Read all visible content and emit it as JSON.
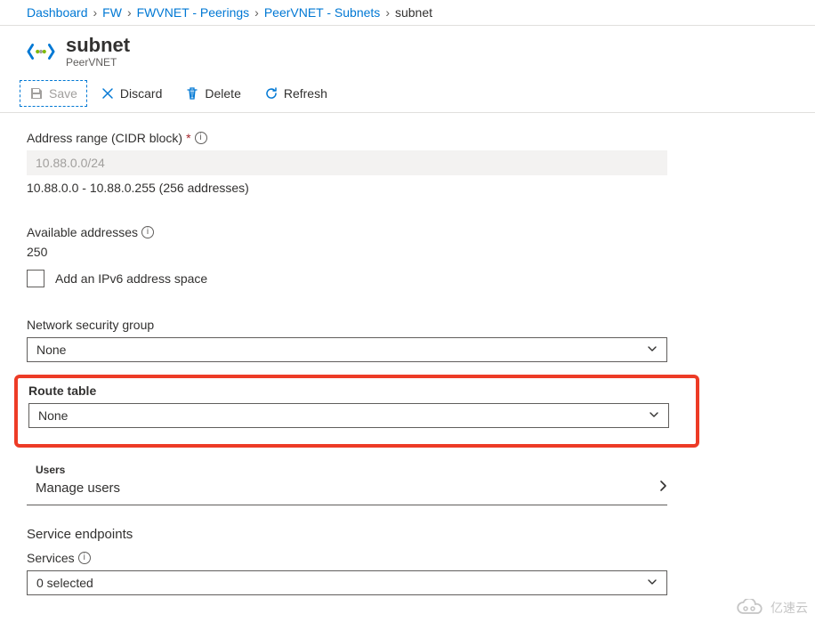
{
  "breadcrumb": {
    "items": [
      {
        "label": "Dashboard"
      },
      {
        "label": "FW"
      },
      {
        "label": "FWVNET - Peerings"
      },
      {
        "label": "PeerVNET - Subnets"
      }
    ],
    "current": "subnet"
  },
  "header": {
    "title": "subnet",
    "subtitle": "PeerVNET"
  },
  "toolbar": {
    "save": "Save",
    "discard": "Discard",
    "delete": "Delete",
    "refresh": "Refresh"
  },
  "form": {
    "addressRange": {
      "label": "Address range (CIDR block)",
      "value": "10.88.0.0/24",
      "hint": "10.88.0.0 - 10.88.0.255 (256 addresses)"
    },
    "availableAddresses": {
      "label": "Available addresses",
      "value": "250"
    },
    "ipv6Checkbox": {
      "label": "Add an IPv6 address space",
      "checked": false
    },
    "nsg": {
      "label": "Network security group",
      "value": "None"
    },
    "routeTable": {
      "label": "Route table",
      "value": "None"
    },
    "users": {
      "label": "Users",
      "action": "Manage users"
    },
    "serviceEndpoints": {
      "title": "Service endpoints",
      "servicesLabel": "Services",
      "value": "0 selected"
    }
  },
  "watermark": "亿速云"
}
